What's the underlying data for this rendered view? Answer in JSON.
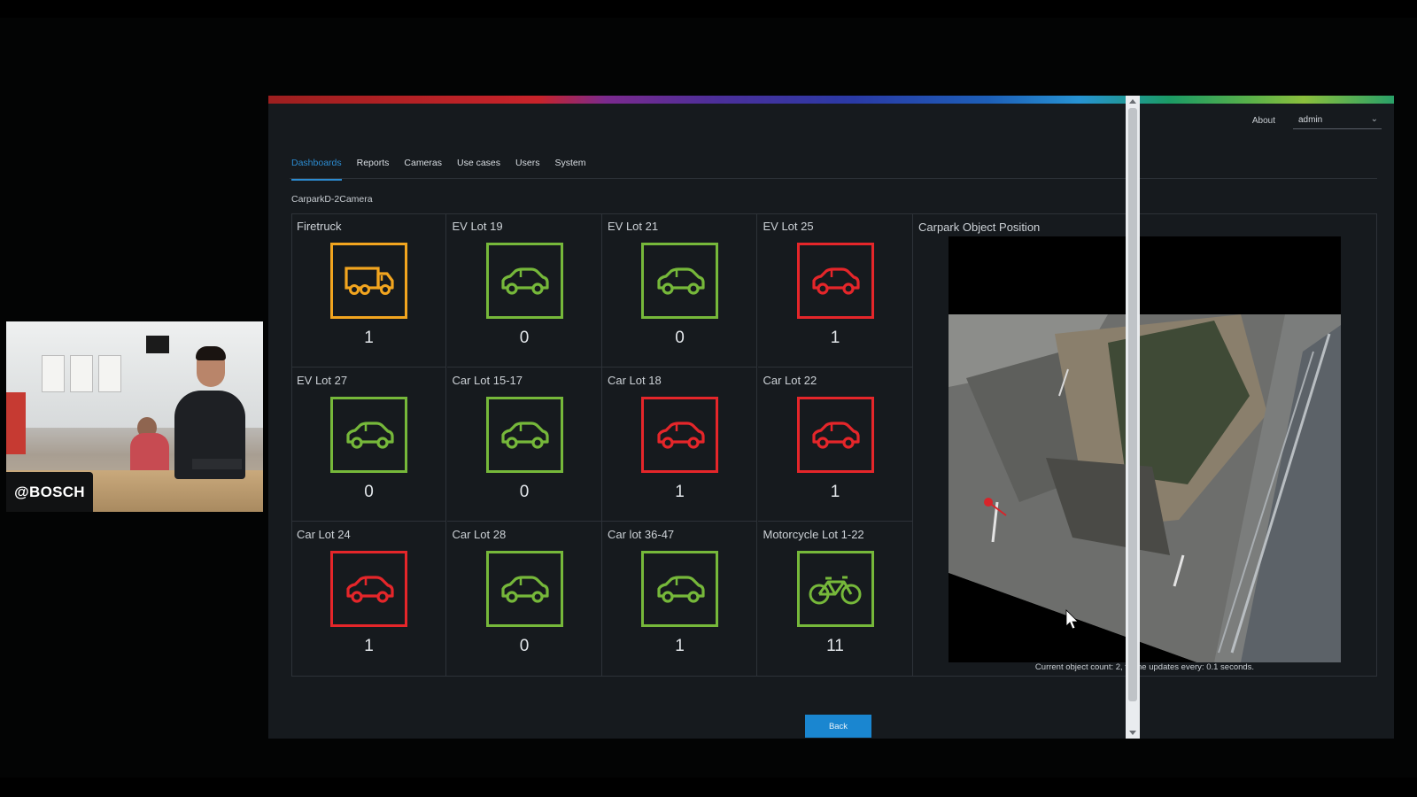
{
  "overlay": {
    "tag": "@BOSCH"
  },
  "header": {
    "about": "About",
    "user": "admin"
  },
  "nav": {
    "tabs": [
      {
        "label": "Dashboards"
      },
      {
        "label": "Reports"
      },
      {
        "label": "Cameras"
      },
      {
        "label": "Use cases"
      },
      {
        "label": "Users"
      },
      {
        "label": "System"
      }
    ],
    "active": "Dashboards"
  },
  "page": {
    "title": "CarparkD-2Camera"
  },
  "lots": [
    {
      "label": "Firetruck",
      "count": "1",
      "icon": "truck-icon",
      "status": "orange"
    },
    {
      "label": "EV Lot 19",
      "count": "0",
      "icon": "car-icon",
      "status": "green"
    },
    {
      "label": "EV Lot 21",
      "count": "0",
      "icon": "car-icon",
      "status": "green"
    },
    {
      "label": "EV Lot 25",
      "count": "1",
      "icon": "car-icon",
      "status": "red"
    },
    {
      "label": "EV Lot 27",
      "count": "0",
      "icon": "car-icon",
      "status": "green"
    },
    {
      "label": "Car Lot 15-17",
      "count": "0",
      "icon": "car-icon",
      "status": "green"
    },
    {
      "label": "Car Lot 18",
      "count": "1",
      "icon": "car-icon",
      "status": "red"
    },
    {
      "label": "Car Lot 22",
      "count": "1",
      "icon": "car-icon",
      "status": "red"
    },
    {
      "label": "Car Lot 24",
      "count": "1",
      "icon": "car-icon",
      "status": "red"
    },
    {
      "label": "Car Lot 28",
      "count": "0",
      "icon": "car-icon",
      "status": "green"
    },
    {
      "label": "Car lot 36-47",
      "count": "1",
      "icon": "car-icon",
      "status": "green"
    },
    {
      "label": "Motorcycle Lot 1-22",
      "count": "11",
      "icon": "bicycle-icon",
      "status": "green"
    }
  ],
  "status_colors": {
    "green": "#76b83a",
    "red": "#e5262a",
    "orange": "#f2a51f"
  },
  "position_panel": {
    "title": "Carpark Object Position",
    "caption": "Current object count: 2, frame updates every: 0.1 seconds."
  },
  "actions": {
    "back": "Back"
  },
  "colors": {
    "accent": "#1a86d0",
    "background": "#161a1e"
  }
}
